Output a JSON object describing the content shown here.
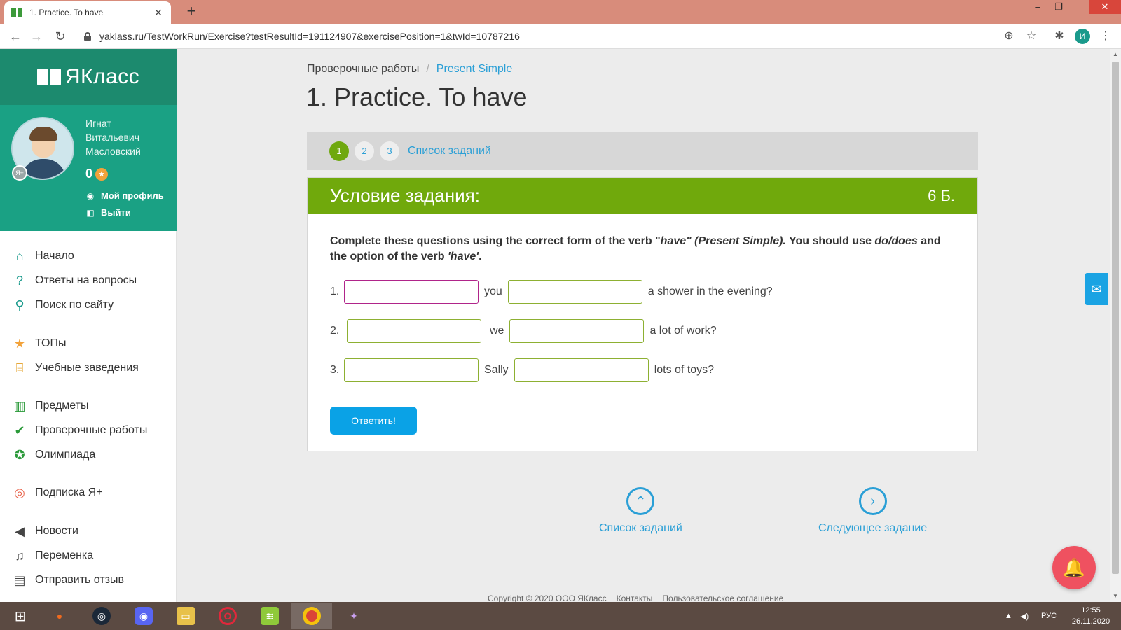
{
  "browser": {
    "tab_title": "1. Practice. To have",
    "tab_close": "✕",
    "new_tab": "+",
    "url": "yaklass.ru/TestWorkRun/Exercise?testResultId=191124907&exercisePosition=1&twId=10787216",
    "profile_letter": "И",
    "win_min": "–",
    "win_max": "❐",
    "win_close": "✕"
  },
  "sidebar": {
    "logo": "ЯКласс",
    "user": {
      "name_lines": [
        "Игнат",
        "Витальевич",
        "Масловский"
      ],
      "points": "0",
      "badge": "Я+",
      "links": [
        "Мой профиль",
        "Выйти"
      ]
    },
    "nav": [
      {
        "label": "Начало",
        "icon": "home-icon"
      },
      {
        "label": "Ответы на вопросы",
        "icon": "question-icon"
      },
      {
        "label": "Поиск по сайту",
        "icon": "search-icon"
      },
      {
        "label": "ТОПы",
        "icon": "star-icon"
      },
      {
        "label": "Учебные заведения",
        "icon": "institution-icon"
      },
      {
        "label": "Предметы",
        "icon": "book-icon"
      },
      {
        "label": "Проверочные работы",
        "icon": "check-icon"
      },
      {
        "label": "Олимпиада",
        "icon": "medal-icon"
      },
      {
        "label": "Подписка Я+",
        "icon": "subscription-icon"
      },
      {
        "label": "Новости",
        "icon": "megaphone-icon"
      },
      {
        "label": "Переменка",
        "icon": "bell-icon"
      },
      {
        "label": "Отправить отзыв",
        "icon": "feedback-icon"
      }
    ]
  },
  "main": {
    "breadcrumb": [
      "Проверочные работы",
      "Present Simple"
    ],
    "breadcrumb_sep": "/",
    "title": "1. Practice. To have",
    "steps": [
      "1",
      "2",
      "3"
    ],
    "steps_link": "Список заданий",
    "task": {
      "header": "Условие задания:",
      "points": "6 Б.",
      "text_parts": {
        "a": "Complete these questions using the correct form of the verb \"",
        "b": "have\" (Present Simple).",
        "c": " You should use ",
        "d": "do/does",
        "e": " and the option of the verb ",
        "f": "'have'",
        "g": "."
      },
      "questions": [
        {
          "num": "1.",
          "word": "you",
          "rest": "a shower in the evening?"
        },
        {
          "num": "2.",
          "word": "we",
          "rest": "a lot of work?"
        },
        {
          "num": "3.",
          "word": "Sally",
          "rest": "lots of toys?"
        }
      ],
      "submit": "Ответить!"
    },
    "bottom_nav": {
      "list": "Список заданий",
      "next": "Следующее задание"
    },
    "footer": [
      "Copyright © 2020 ООО ЯКласс",
      "Контакты",
      "Пользовательское соглашение"
    ]
  },
  "taskbar": {
    "lang": "РУС",
    "time": "12:55",
    "date": "26.11.2020"
  }
}
